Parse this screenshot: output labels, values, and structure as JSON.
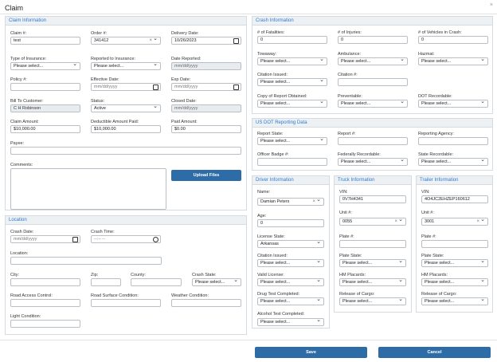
{
  "window": {
    "title": "Claim"
  },
  "claim": {
    "header": "Claim Information",
    "claim_no_label": "Claim #:",
    "claim_no": "test",
    "order_label": "Order #:",
    "order": "341412",
    "delivery_label": "Delivery Date:",
    "delivery": "10/26/2023",
    "insurance_type_label": "Type of Insurance:",
    "insurance_type": "Please select...",
    "reported_to_label": "Reported to Insurance:",
    "reported_to": "Please select...",
    "date_reported_label": "Date Reported:",
    "date_reported_ph": "mm/dd/yyyy",
    "policy_label": "Policy #:",
    "effective_label": "Effective Date:",
    "effective_ph": "mm/dd/yyyy",
    "exp_label": "Exp Date:",
    "exp_ph": "mm/dd/yyyy",
    "bill_label": "Bill To Customer:",
    "bill": "C H Robinson",
    "status_label": "Status:",
    "status": "Active",
    "closed_label": "Closed Date:",
    "closed_ph": "mm/dd/yyyy",
    "claim_amount_label": "Claim Amount:",
    "claim_amount": "$10,000.00",
    "deductible_label": "Deductible Amount Paid:",
    "deductible": "$10,000.00",
    "paid_label": "Paid Amount:",
    "paid": "$0.00",
    "payee_label": "Payee:",
    "comments_label": "Comments:",
    "upload_label": "Upload Files"
  },
  "location": {
    "header": "Location",
    "crash_date_label": "Crash Date:",
    "crash_date_ph": "mm/dd/yyyy",
    "crash_time_label": "Crash Time:",
    "crash_time_ph": "--:-- --",
    "location_label": "Location:",
    "city_label": "City:",
    "zip_label": "Zip:",
    "county_label": "County:",
    "state_label": "Crash State:",
    "state": "Please select...",
    "road_access_label": "Road Access Control:",
    "road_surface_label": "Road Surface Condition:",
    "weather_label": "Weather Condition:",
    "light_label": "Light Condition:"
  },
  "crash": {
    "header": "Crash Information",
    "fatal_label": "# of Fatalities:",
    "fatal": "0",
    "injuries_label": "# of Injuries:",
    "injuries": "0",
    "vehicles_label": "# of Vehicles in Crash:",
    "vehicles": "0",
    "towaway_label": "Towaway:",
    "towaway": "Please select...",
    "ambulance_label": "Ambulance:",
    "ambulance": "Please select...",
    "hazmat_label": "Hazmat:",
    "hazmat": "Please select...",
    "citation_issued_label": "Citation Issued:",
    "citation_issued": "Please select...",
    "citation_no_label": "Citation #:",
    "copy_label": "Copy of Report Obtained:",
    "copy": "Please select...",
    "preventable_label": "Preventable:",
    "preventable": "Please select...",
    "dot_rec_label": "DOT Recordable:",
    "dot_rec": "Please select..."
  },
  "dot": {
    "header": "US DOT Reporting Data",
    "report_state_label": "Report State:",
    "report_state": "Please select...",
    "report_no_label": "Report #:",
    "agency_label": "Reporting Agency:",
    "badge_label": "Officer Badge #:",
    "fed_label": "Federally Recordable:",
    "fed": "Please select...",
    "state_rec_label": "State Recordable:",
    "state_rec": "Please select..."
  },
  "driver": {
    "header": "Driver Information",
    "name_label": "Name:",
    "name": "Damian Peters",
    "age_label": "Age:",
    "age": "0",
    "license_state_label": "License State:",
    "license_state": "Arkansas",
    "citation_label": "Citation Issued:",
    "citation": "Please select...",
    "valid_label": "Valid License:",
    "valid": "Please select...",
    "drug_label": "Drug Test Completed:",
    "drug": "Please select...",
    "alcohol_label": "Alcohol Test Completed:",
    "alcohol": "Please select..."
  },
  "truck": {
    "header": "Truck Information",
    "vin_label": "VIN:",
    "vin": "0V7H4341",
    "unit_label": "Unit #:",
    "unit": "0055",
    "plate_label": "Plate #:",
    "plate_state_label": "Plate State:",
    "plate_state": "Please select...",
    "hm_label": "HM Placards:",
    "hm": "Please select...",
    "release_label": "Release of Cargo:",
    "release": "Please select..."
  },
  "trailer": {
    "header": "Trailer Information",
    "vin_label": "VIN:",
    "vin": "4O4JC2EHZEP160612",
    "unit_label": "Unit #:",
    "unit": "3001",
    "plate_label": "Plate #:",
    "plate_state_label": "Plate State:",
    "plate_state": "Please select...",
    "hm_label": "HM Placards:",
    "hm": "Please select...",
    "release_label": "Release of Cargo:",
    "release": "Please select..."
  },
  "footer": {
    "save": "Save",
    "cancel": "Cancel"
  }
}
